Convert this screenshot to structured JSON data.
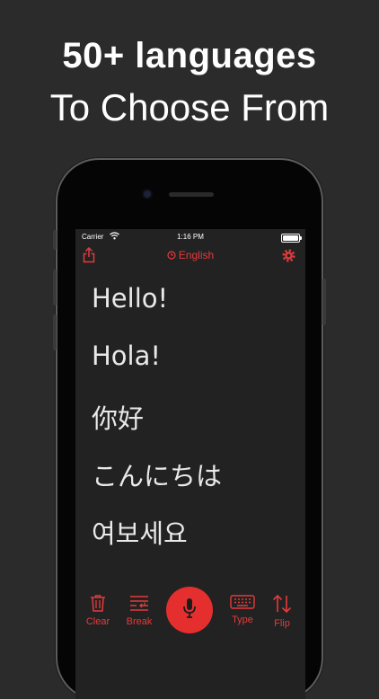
{
  "headline": {
    "line1": "50+ languages",
    "line2": "To Choose From"
  },
  "statusbar": {
    "carrier": "Carrier",
    "time": "1:16 PM"
  },
  "topbar": {
    "language": "English",
    "icons": [
      "share-icon",
      "clock-icon",
      "gear-icon"
    ]
  },
  "phrases": [
    "Hello!",
    "Hola!",
    "你好",
    "こんにちは",
    "여보세요"
  ],
  "toolbar": {
    "clear_label": "Clear",
    "break_label": "Break",
    "type_label": "Type",
    "flip_label": "Flip",
    "icons": [
      "trash-icon",
      "break-icon",
      "microphone-icon",
      "keyboard-icon",
      "flip-arrows-icon"
    ]
  },
  "colors": {
    "accent": "#e33b3b",
    "background": "#2b2b2c",
    "screen": "#222223"
  }
}
